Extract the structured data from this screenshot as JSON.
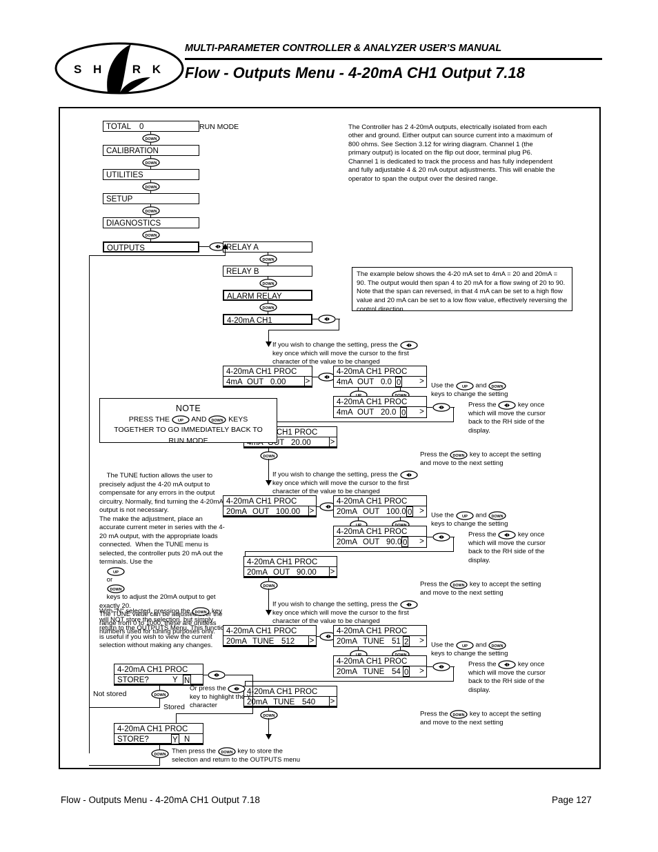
{
  "header": {
    "subtitle": "MULTI-PARAMETER CONTROLLER & ANALYZER USER’S MANUAL",
    "title": "Flow - Outputs Menu - 4-20mA CH1 Output 7.18",
    "logo_text": "S H A R K"
  },
  "footer": {
    "left": "Flow - Outputs Menu - 4-20mA CH1 Output 7.18",
    "right": "Page 127"
  },
  "keys": {
    "up": "UP",
    "down": "DOWN",
    "leftright": "◄►"
  },
  "menu": {
    "run_mode_label": "RUN MODE",
    "items": [
      {
        "label": "TOTAL",
        "value": "0"
      },
      {
        "label": "CALIBRATION",
        "value": ""
      },
      {
        "label": "UTILITIES",
        "value": ""
      },
      {
        "label": "SETUP",
        "value": ""
      },
      {
        "label": "DIAGNOSTICS",
        "value": ""
      },
      {
        "label": "OUTPUTS",
        "value": ""
      }
    ],
    "submenu": [
      {
        "label": "RELAY A"
      },
      {
        "label": "RELAY B"
      },
      {
        "label": "ALARM RELAY"
      },
      {
        "label": "4-20mA CH1"
      }
    ]
  },
  "intro_text": "The Controller has 2 4-20mA outputs, electrically isolated from each other and ground. Either output can source current into a maximum of 800 ohms. See Section 3.12 for wiring diagram. Channel 1 (the primary output) is located on the flip out door, terminal plug P6. Channel 1 is dedicated to track the process and has fully independent and fully adjustable 4 & 20 mA output adjustments. This will enable the operator to span the output over the desired range.",
  "example_box_text": "The example below shows the 4-20 mA set to 4mA = 20 and 20mA = 90. The output would then span 4 to 20 mA for a flow swing of 20 to 90. Note that the span can reversed, in that 4 mA can be set to a high flow value and 20 mA can be set to a low flow value, effectively reversing the control direction.",
  "note_box": {
    "title": "NOTE",
    "line1a": "PRESS THE",
    "line1b": "AND",
    "line1c": "KEYS",
    "line2": "TOGETHER TO GO IMMEDIATELY BACK TO",
    "line3": "RUN MODE"
  },
  "tune_text": "The TUNE fuction allows the user to precisely adjust the 4-20 mA output to compensate for any errors in the output circuitry. Normally, find turning the 4-20mA output is not necessary.\nThe make the adjustment, place an accurate current meter in series with the 4-20 mA output, with the appropriate loads connected.  When the TUNE menu is selected, the controller puts 20 mA out the terminals. Use the",
  "tune_text_2": "or",
  "tune_text_3": "keys to adjust the 20mA output to get exactly 20.\nThe TUNE value can be adjusted over the range from 0 to 1000, these are unitless numbers used for tuning purposes only.",
  "n_selected_text_1": "With \"N\" selected, pressing the",
  "n_selected_text_2": "key will NOT store the selection, but simply return to the OUTPUTS Menu. This function is useful if you wish to view the current selection without making any changes.",
  "instructions": {
    "change_setting_a": "If you wish to change the setting, press the",
    "change_setting_b": "key once which will move the cursor to the first character of the value to be changed",
    "use_up_down_a": "Use the",
    "use_up_down_b": "and",
    "use_up_down_c": "keys to change the setting",
    "press_lr_a": "Press the",
    "press_lr_b": "key once which will move the cursor back to the RH side of the display.",
    "press_down_a": "Press the",
    "press_down_b": "key to accept the setting and move to the next setting"
  },
  "store": {
    "not_stored": "Not stored",
    "stored": "Stored",
    "or_press_a": "Or press the",
    "or_press_b": "key to highlight the Y character",
    "then_press_a": "Then press the",
    "then_press_b": "key to store the selection and return to the OUTPUTS menu",
    "prompt": "STORE?",
    "y": "Y",
    "n": "N"
  },
  "displays": {
    "title": "4-20mA CH1 PROC",
    "seq_4ma": [
      {
        "f1": "4mA",
        "f2": "OUT",
        "f3": "0.00",
        "cursor": "",
        "rh": ">"
      },
      {
        "f1": "4mA",
        "f2": "OUT",
        "f3": "0.0",
        "cursor": "0",
        "rh": ">"
      },
      {
        "f1": "4mA",
        "f2": "OUT",
        "f3": "20.0",
        "cursor": "0",
        "rh": ">"
      },
      {
        "f1": "4mA",
        "f2": "OUT",
        "f3": "20.00",
        "cursor": "",
        "rh": ">"
      }
    ],
    "seq_20ma": [
      {
        "f1": "20mA",
        "f2": "OUT",
        "f3": "100.00",
        "cursor": "",
        "rh": ">"
      },
      {
        "f1": "20mA",
        "f2": "OUT",
        "f3": "100.0",
        "cursor": "0",
        "rh": ">"
      },
      {
        "f1": "20mA",
        "f2": "OUT",
        "f3": "90.0",
        "cursor": "0",
        "rh": ">"
      },
      {
        "f1": "20mA",
        "f2": "OUT",
        "f3": "90.00",
        "cursor": "",
        "rh": ">"
      }
    ],
    "seq_tune": [
      {
        "f1": "20mA",
        "f2": "TUNE",
        "f3": "512",
        "cursor": "",
        "rh": ">"
      },
      {
        "f1": "20mA",
        "f2": "TUNE",
        "f3": "51",
        "cursor": "2",
        "rh": ">"
      },
      {
        "f1": "20mA",
        "f2": "TUNE",
        "f3": "54",
        "cursor": "0",
        "rh": ">"
      },
      {
        "f1": "20mA",
        "f2": "TUNE",
        "f3": "540",
        "cursor": "",
        "rh": ">"
      }
    ]
  }
}
